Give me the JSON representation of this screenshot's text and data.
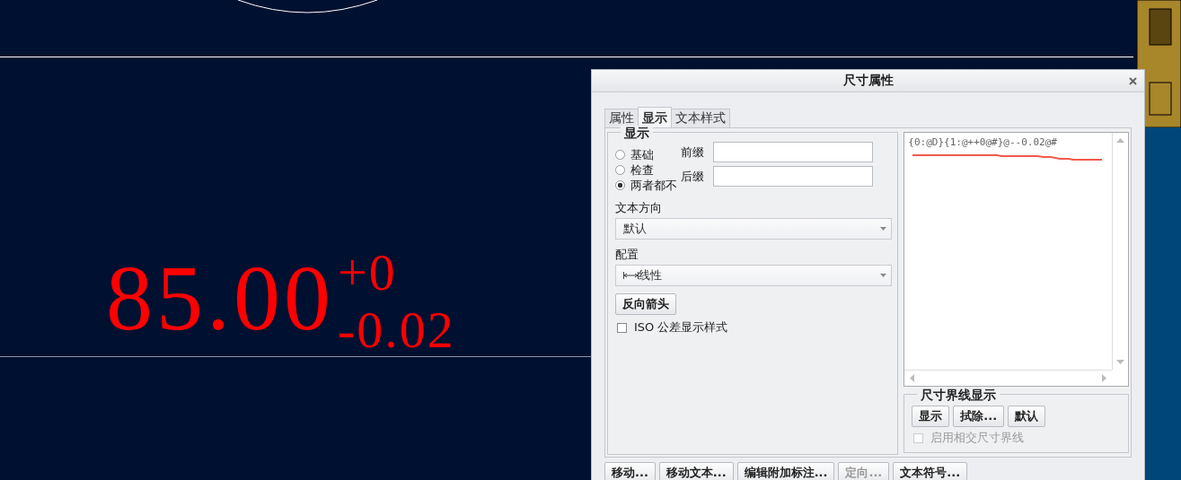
{
  "canvas": {
    "dimension": {
      "value": "85.00",
      "upper_tolerance": "+0",
      "lower_tolerance": "-0.02"
    }
  },
  "dialog": {
    "title": "尺寸属性",
    "tabs": [
      {
        "label": "属性",
        "selected": false
      },
      {
        "label": "显示",
        "selected": true
      },
      {
        "label": "文本样式",
        "selected": false
      }
    ],
    "display_group": {
      "title": "显示",
      "radios": [
        {
          "label": "基础",
          "selected": false
        },
        {
          "label": "检查",
          "selected": false
        },
        {
          "label": "两者都不",
          "selected": true
        }
      ],
      "prefix_label": "前缀",
      "suffix_label": "后缀",
      "text_orientation": {
        "label": "文本方向",
        "value": "默认"
      },
      "configuration": {
        "label": "配置",
        "value": "线性"
      },
      "flip_arrows_button": "反向箭头",
      "iso_tolerance": {
        "label": "ISO 公差显示样式",
        "checked": false
      }
    },
    "text_editor": {
      "value": "{0:@D}{1:@++0@#}@--0.02@#"
    },
    "witness_line_group": {
      "title": "尺寸界线显示",
      "buttons": [
        "显示",
        "拭除...",
        "默认"
      ],
      "intersect_option": {
        "label": "启用相交尺寸界线",
        "checked": false,
        "disabled": true
      }
    },
    "buttons": [
      {
        "label": "移动...",
        "disabled": false
      },
      {
        "label": "移动文本...",
        "disabled": false
      },
      {
        "label": "编辑附加标注...",
        "disabled": false
      },
      {
        "label": "定向...",
        "disabled": true
      },
      {
        "label": "文本符号...",
        "disabled": false
      }
    ]
  }
}
